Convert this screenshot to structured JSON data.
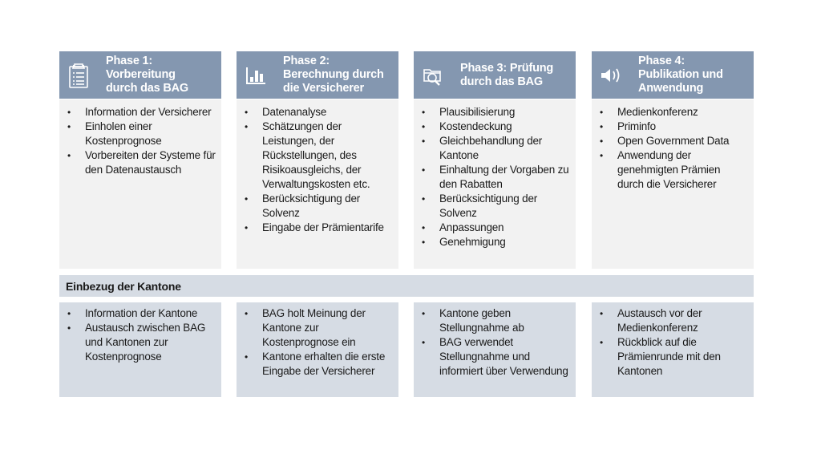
{
  "phases": [
    {
      "icon": "clipboard-checklist-icon",
      "title": "Phase 1:\nVorbereitung\ndurch das BAG",
      "items": [
        "Information der Versicherer",
        "Einholen einer Kostenprognose",
        "Vorbereiten der Systeme für den Datenaustausch"
      ]
    },
    {
      "icon": "bar-chart-icon",
      "title": "Phase 2:\nBerechnung durch\ndie Versicherer",
      "items": [
        "Datenanalyse",
        "Schätzungen der Leistungen, der Rückstellungen, des Risikoausgleichs, der Verwaltungskosten etc.",
        "Berücksichtigung der Solvenz",
        "Eingabe der Prämientarife"
      ]
    },
    {
      "icon": "folder-search-icon",
      "title": "Phase 3: Prüfung\ndurch das BAG",
      "items": [
        "Plausibilisierung",
        "Kostendeckung",
        "Gleichbehandlung der Kantone",
        "Einhaltung der Vorgaben zu den Rabatten",
        "Berücksichtigung der Solvenz",
        "Anpassungen",
        "Genehmigung"
      ]
    },
    {
      "icon": "speaker-icon",
      "title": "Phase 4:\nPublikation und\nAnwendung",
      "items": [
        "Medienkonferenz",
        "Priminfo",
        "Open Government Data",
        "Anwendung der genehmigten Prämien durch die Versicherer"
      ]
    }
  ],
  "kantone": {
    "heading": "Einbezug der Kantone",
    "columns": [
      {
        "items": [
          "Information der Kantone",
          "Austausch zwischen BAG und Kantonen zur Kostenprognose"
        ]
      },
      {
        "items": [
          "BAG holt Meinung der Kantone zur Kostenprognose ein",
          "Kantone erhalten die erste Eingabe der Versicherer"
        ]
      },
      {
        "items": [
          "Kantone geben Stellungnahme ab",
          "BAG verwendet Stellungnahme und informiert über Verwendung"
        ]
      },
      {
        "items": [
          "Austausch vor der Medienkonferenz",
          "Rückblick auf die Prämienrunde mit den Kantonen"
        ]
      }
    ]
  },
  "bullet": "•",
  "colors": {
    "header": "#8497b0",
    "phase_body": "#f2f2f2",
    "kantone": "#d6dce4"
  }
}
